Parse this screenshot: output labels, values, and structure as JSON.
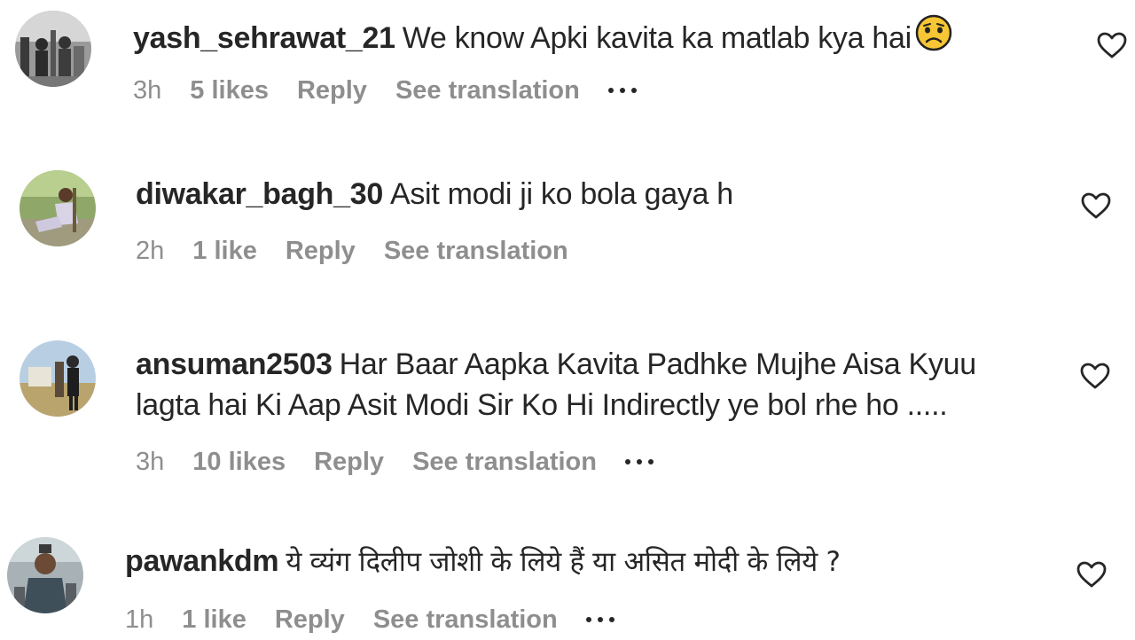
{
  "comments": [
    {
      "username": "yash_sehrawat_21",
      "text": "We know Apki kavita ka matlab kya hai",
      "emoji": "worried-face-emoji",
      "time": "3h",
      "likes": "5 likes",
      "reply": "Reply",
      "translate": "See translation",
      "has_more": true
    },
    {
      "username": "diwakar_bagh_30",
      "text": "Asit modi ji ko bola gaya h",
      "time": "2h",
      "likes": "1 like",
      "reply": "Reply",
      "translate": "See translation",
      "has_more": false
    },
    {
      "username": "ansuman2503",
      "text_line1": "Har Baar Aapka Kavita Padhke Mujhe Aisa Kyuu",
      "text_line2": "lagta hai Ki Aap Asit Modi Sir Ko Hi Indirectly ye bol rhe ho .....",
      "time": "3h",
      "likes": "10 likes",
      "reply": "Reply",
      "translate": "See translation",
      "has_more": true
    },
    {
      "username": "pawankdm",
      "text": "ये व्यंग दिलीप जोशी के लिये हैं या असित मोदी के लिये ?",
      "time": "1h",
      "likes": "1 like",
      "reply": "Reply",
      "translate": "See translation",
      "has_more": true
    }
  ],
  "icons": {
    "like": "heart-outline-icon",
    "more": "more-options-icon"
  },
  "colors": {
    "text": "#262626",
    "secondary": "#8e8e8e",
    "background": "#ffffff"
  }
}
